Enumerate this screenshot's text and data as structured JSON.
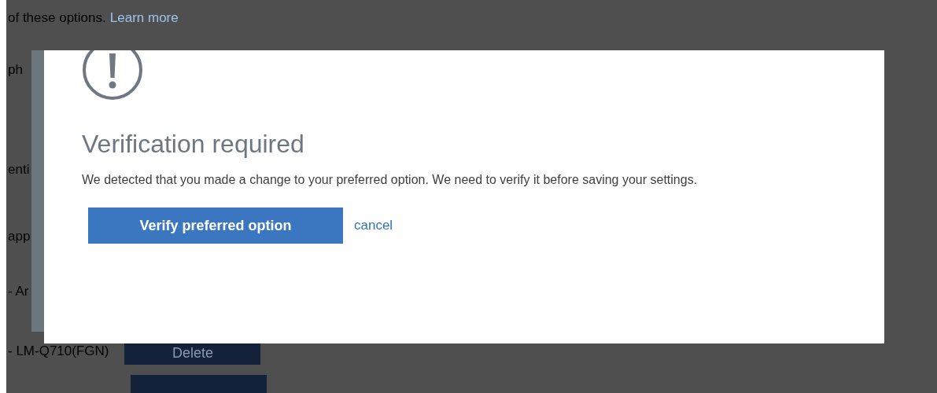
{
  "background_page": {
    "intro_text": "of these options.",
    "learn_more_link": "Learn more",
    "rows": [
      {
        "label": "ph",
        "button": null
      },
      {
        "label": "enti",
        "button": null
      },
      {
        "label": "app",
        "button": null
      },
      {
        "label": "- Ar",
        "button": null
      },
      {
        "label": "- LM-Q710(FGN)",
        "button": "Delete"
      }
    ]
  },
  "dialog": {
    "title": "Verification required",
    "message": "We detected that you made a change to your preferred option. We need to verify it before saving your settings.",
    "primary_button": "Verify preferred option",
    "cancel_link": "cancel"
  }
}
